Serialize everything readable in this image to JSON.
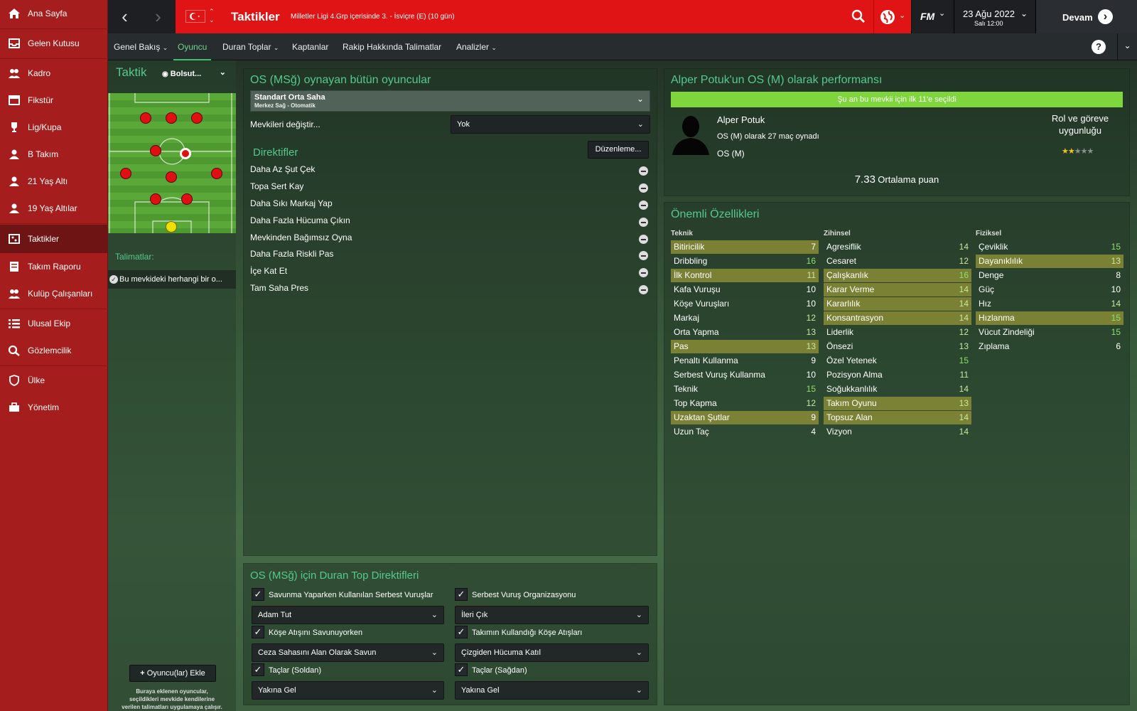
{
  "sidebar": {
    "items": [
      {
        "label": "Ana Sayfa",
        "icon": "home-icon"
      },
      {
        "label": "Gelen Kutusu",
        "icon": "inbox-icon"
      },
      {
        "label": "Kadro",
        "icon": "squad-icon"
      },
      {
        "label": "Fikstür",
        "icon": "calendar-icon"
      },
      {
        "label": "Lig/Kupa",
        "icon": "trophy-icon"
      },
      {
        "label": "B Takım",
        "icon": "team-b-icon"
      },
      {
        "label": "21 Yaş Altı",
        "icon": "u21-icon"
      },
      {
        "label": "19 Yaş Altılar",
        "icon": "u19-icon"
      },
      {
        "label": "Taktikler",
        "icon": "tactics-icon"
      },
      {
        "label": "Takım Raporu",
        "icon": "report-icon"
      },
      {
        "label": "Kulüp Çalışanları",
        "icon": "staff-icon"
      },
      {
        "label": "Ulusal Ekip",
        "icon": "list-icon"
      },
      {
        "label": "Gözlemcilik",
        "icon": "search-icon"
      },
      {
        "label": "Ülke",
        "icon": "shield-icon"
      },
      {
        "label": "Yönetim",
        "icon": "briefcase-icon"
      }
    ]
  },
  "header": {
    "title": "Taktikler",
    "subtitle": "Milletler Ligi 4.Grp içerisinde 3. - İsviçre (E) (10 gün)",
    "brand": "FM",
    "date": "23 Ağu 2022",
    "time": "Salı 12:00",
    "continue_label": "Devam"
  },
  "tabs": [
    "Genel Bakış",
    "Oyuncu",
    "Duran Toplar",
    "Kaptanlar",
    "Rakip Hakkında Talimatlar",
    "Analizler"
  ],
  "left": {
    "title": "Taktik",
    "view_label": "Bolsut...",
    "instructions_title": "Talimatlar:",
    "instruction_item": "Bu mevkideki herhangi bir o...",
    "add_button": "Oyuncu(lar) Ekle",
    "add_note_1": "Buraya eklenen oyuncular,",
    "add_note_2": "seçildikleri mevkide kendilerine",
    "add_note_3": "verilen talimatları uygulamaya çalışır."
  },
  "players_panel": {
    "title": "OS (MSğ) oynayan bütün oyuncular",
    "role_name": "Standart Orta Saha",
    "role_sub": "Merkez Sağ - Otomatik",
    "change_label": "Mevkileri değiştir...",
    "change_value": "Yok",
    "directives_title": "Direktifler",
    "edit_button": "Düzenleme...",
    "directives": [
      "Daha Az Şut Çek",
      "Topa Sert Kay",
      "Daha Sıkı Markaj Yap",
      "Daha Fazla Hücuma Çıkın",
      "Mevkinden Bağımsız Oyna",
      "Daha Fazla Riskli Pas",
      "İçe Kat Et",
      "Tam Saha Pres"
    ]
  },
  "setpiece": {
    "title": "OS (MSğ) için Duran Top Direktifleri",
    "left": [
      {
        "check": "Savunma Yaparken Kullanılan Serbest Vuruşlar",
        "value": "Adam Tut"
      },
      {
        "check": "Köşe Atışını Savunuyorken",
        "value": "Ceza Sahasını Alan Olarak Savun"
      },
      {
        "check": "Taçlar (Soldan)",
        "value": "Yakına Gel"
      }
    ],
    "right": [
      {
        "check": "Serbest Vuruş Organizasyonu",
        "value": "İleri Çık"
      },
      {
        "check": "Takımın Kullandığı Köşe Atışları",
        "value": "Çizgiden Hücuma Katıl"
      },
      {
        "check": "Taçlar (Sağdan)",
        "value": "Yakına Gel"
      }
    ]
  },
  "performance": {
    "title": "Alper Potuk'un OS (M) olarak performansı",
    "banner": "Şu an bu mevkii için ilk 11'e seçildi",
    "player_name": "Alper Potuk",
    "apps": "OS (M) olarak 27 maç oynadı",
    "position": "OS (M)",
    "suitability_label_1": "Rol ve göreve",
    "suitability_label_2": "uygunluğu",
    "stars": 2,
    "stars_max": 5,
    "rating": "7.33",
    "rating_label": "Ortalama puan"
  },
  "attributes": {
    "title": "Önemli Özellikleri",
    "columns": [
      {
        "name": "Teknik",
        "items": [
          {
            "n": "Bitiricilik",
            "v": "7",
            "hl": true
          },
          {
            "n": "Dribbling",
            "v": "16",
            "hl": false
          },
          {
            "n": "İlk Kontrol",
            "v": "11",
            "hl": true
          },
          {
            "n": "Kafa Vuruşu",
            "v": "10",
            "hl": false
          },
          {
            "n": "Köşe Vuruşları",
            "v": "10",
            "hl": false
          },
          {
            "n": "Markaj",
            "v": "12",
            "hl": false
          },
          {
            "n": "Orta Yapma",
            "v": "13",
            "hl": false
          },
          {
            "n": "Pas",
            "v": "13",
            "hl": true
          },
          {
            "n": "Penaltı Kullanma",
            "v": "9",
            "hl": false
          },
          {
            "n": "Serbest Vuruş Kullanma",
            "v": "10",
            "hl": false
          },
          {
            "n": "Teknik",
            "v": "15",
            "hl": false
          },
          {
            "n": "Top Kapma",
            "v": "12",
            "hl": false
          },
          {
            "n": "Uzaktan Şutlar",
            "v": "9",
            "hl": true
          },
          {
            "n": "Uzun Taç",
            "v": "4",
            "hl": false
          }
        ]
      },
      {
        "name": "Zihinsel",
        "items": [
          {
            "n": "Agresiflik",
            "v": "14",
            "hl": false
          },
          {
            "n": "Cesaret",
            "v": "12",
            "hl": false
          },
          {
            "n": "Çalışkanlık",
            "v": "16",
            "hl": true
          },
          {
            "n": "Karar Verme",
            "v": "14",
            "hl": true
          },
          {
            "n": "Kararlılık",
            "v": "14",
            "hl": true
          },
          {
            "n": "Konsantrasyon",
            "v": "14",
            "hl": true
          },
          {
            "n": "Liderlik",
            "v": "12",
            "hl": false
          },
          {
            "n": "Önsezi",
            "v": "13",
            "hl": false
          },
          {
            "n": "Özel Yetenek",
            "v": "15",
            "hl": false
          },
          {
            "n": "Pozisyon Alma",
            "v": "11",
            "hl": false
          },
          {
            "n": "Soğukkanlılık",
            "v": "14",
            "hl": false
          },
          {
            "n": "Takım Oyunu",
            "v": "13",
            "hl": true
          },
          {
            "n": "Topsuz Alan",
            "v": "14",
            "hl": true
          },
          {
            "n": "Vizyon",
            "v": "14",
            "hl": false
          }
        ]
      },
      {
        "name": "Fiziksel",
        "items": [
          {
            "n": "Çeviklik",
            "v": "15",
            "hl": false
          },
          {
            "n": "Dayanıklılık",
            "v": "13",
            "hl": true
          },
          {
            "n": "Denge",
            "v": "8",
            "hl": false
          },
          {
            "n": "Güç",
            "v": "10",
            "hl": false
          },
          {
            "n": "Hız",
            "v": "14",
            "hl": false
          },
          {
            "n": "Hızlanma",
            "v": "15",
            "hl": true
          },
          {
            "n": "Vücut Zindeliği",
            "v": "15",
            "hl": false
          },
          {
            "n": "Zıplama",
            "v": "6",
            "hl": false
          }
        ]
      }
    ]
  },
  "colors": {
    "brand_red": "#a61d1d",
    "header_red": "#e01414",
    "accent_green": "#55c98c",
    "banner_green": "#7fd63c",
    "high_value": "#8ee06a"
  }
}
